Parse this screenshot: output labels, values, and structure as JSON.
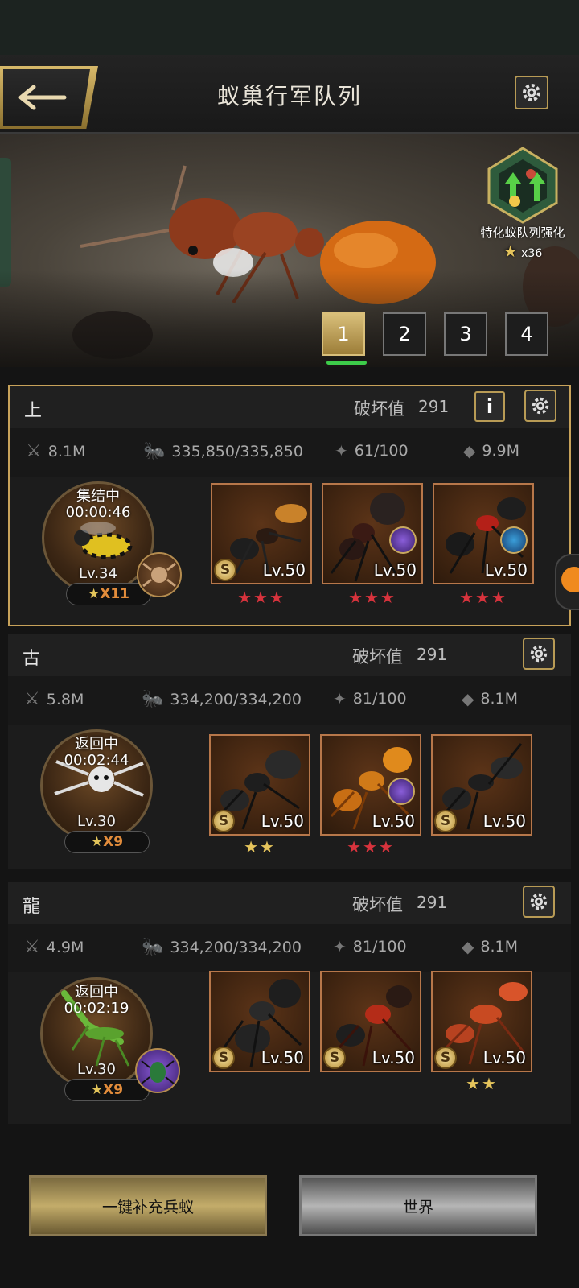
{
  "header": {
    "title": "蚁巢行军队列"
  },
  "banner": {
    "special": {
      "label": "特化蚁队列强化",
      "count": "x36"
    },
    "tabs": [
      "1",
      "2",
      "3",
      "4"
    ],
    "active_tab": "1"
  },
  "squads": [
    {
      "name": "上",
      "destroy_label": "破坏值",
      "destroy_value": "291",
      "stats": {
        "power": "8.1M",
        "troops": "335,850/335,850",
        "load": "61/100",
        "capacity": "9.9M"
      },
      "hero": {
        "status": "集结中",
        "timer": "00:00:46",
        "level": "Lv.34",
        "star_count": "X11"
      },
      "cards": [
        {
          "level": "Lv.50",
          "stars": "★★★",
          "star_color": "red"
        },
        {
          "level": "Lv.50",
          "stars": "★★★",
          "star_color": "red"
        },
        {
          "level": "Lv.50",
          "stars": "★★★",
          "star_color": "red"
        }
      ]
    },
    {
      "name": "古",
      "destroy_label": "破坏值",
      "destroy_value": "291",
      "stats": {
        "power": "5.8M",
        "troops": "334,200/334,200",
        "load": "81/100",
        "capacity": "8.1M"
      },
      "hero": {
        "status": "返回中",
        "timer": "00:02:44",
        "level": "Lv.30",
        "star_count": "X9"
      },
      "cards": [
        {
          "level": "Lv.50",
          "stars": "★★",
          "star_color": "gold"
        },
        {
          "level": "Lv.50",
          "stars": "★★★",
          "star_color": "red"
        },
        {
          "level": "Lv.50",
          "stars": "",
          "star_color": "none"
        }
      ]
    },
    {
      "name": "龍",
      "destroy_label": "破坏值",
      "destroy_value": "291",
      "stats": {
        "power": "4.9M",
        "troops": "334,200/334,200",
        "load": "81/100",
        "capacity": "8.1M"
      },
      "hero": {
        "status": "返回中",
        "timer": "00:02:19",
        "level": "Lv.30",
        "star_count": "X9"
      },
      "cards": [
        {
          "level": "Lv.50",
          "stars": "",
          "star_color": "none"
        },
        {
          "level": "Lv.50",
          "stars": "",
          "star_color": "none"
        },
        {
          "level": "Lv.50",
          "stars": "★★",
          "star_color": "gold"
        }
      ]
    }
  ],
  "badges": {
    "card_badge": "S",
    "hero_star": "★"
  },
  "buttons": {
    "refill": "一键补充兵蚁",
    "world": "世界"
  },
  "colors": {
    "accent_gold": "#c7a25a",
    "active_tab_underline": "#3dcc4a",
    "star_red": "#d8333d",
    "star_gold": "#e5c45c"
  }
}
